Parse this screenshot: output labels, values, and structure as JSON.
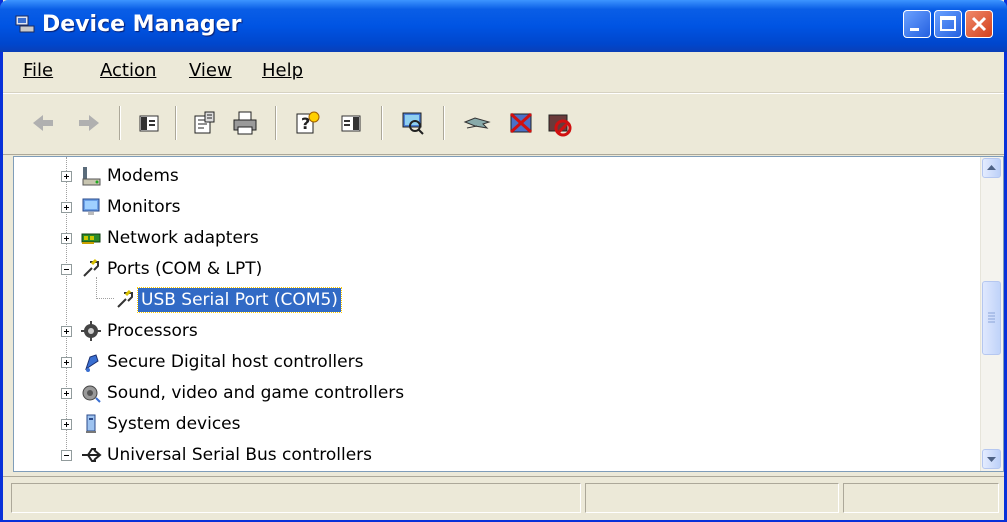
{
  "window": {
    "title": "Device Manager"
  },
  "menu": [
    {
      "label": "File"
    },
    {
      "label": "Action"
    },
    {
      "label": "View"
    },
    {
      "label": "Help"
    }
  ],
  "toolbar": {
    "tools": [
      "back-icon",
      "forward-icon",
      "show-hide-console-tree-icon",
      "properties-icon",
      "print-icon",
      "help-icon",
      "show-hide-action-pane-icon",
      "scan-hardware-changes-icon",
      "update-driver-icon",
      "uninstall-icon",
      "disable-icon"
    ]
  },
  "tree": {
    "items": [
      {
        "label": "Modems",
        "icon": "modem-icon",
        "expanded": false
      },
      {
        "label": "Monitors",
        "icon": "monitor-icon",
        "expanded": false
      },
      {
        "label": "Network adapters",
        "icon": "network-adapter-icon",
        "expanded": false
      },
      {
        "label": "Ports (COM & LPT)",
        "icon": "port-icon",
        "expanded": true
      },
      {
        "label": "USB Serial Port (COM5)",
        "icon": "port-icon",
        "child": true,
        "selected": true
      },
      {
        "label": "Processors",
        "icon": "processor-icon",
        "expanded": false
      },
      {
        "label": "Secure Digital host controllers",
        "icon": "sd-controller-icon",
        "expanded": false
      },
      {
        "label": "Sound, video and game controllers",
        "icon": "sound-icon",
        "expanded": false
      },
      {
        "label": "System devices",
        "icon": "system-device-icon",
        "expanded": false
      },
      {
        "label": "Universal Serial Bus controllers",
        "icon": "usb-icon",
        "expanded": true
      }
    ]
  },
  "status": {
    "pane1": "",
    "pane2": "",
    "pane3": ""
  }
}
